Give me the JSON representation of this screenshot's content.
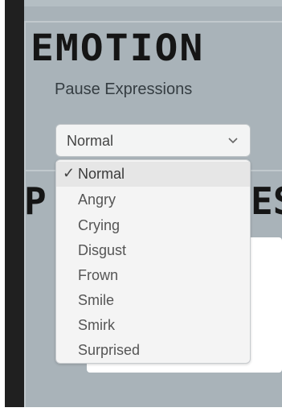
{
  "panel": {
    "emotion_title": "EMOTION",
    "subtitle": "Pause Expressions",
    "second_title_left": "P",
    "second_title_right": "ES"
  },
  "select": {
    "value": "Normal",
    "chevron_icon": "chevron-down-icon"
  },
  "dropdown": {
    "selected_icon": "checkmark-icon",
    "options": [
      {
        "label": "Normal",
        "selected": true
      },
      {
        "label": "Angry"
      },
      {
        "label": "Crying"
      },
      {
        "label": "Disgust"
      },
      {
        "label": "Frown"
      },
      {
        "label": "Smile"
      },
      {
        "label": "Smirk"
      },
      {
        "label": "Surprised"
      }
    ]
  },
  "colors": {
    "panel_bg": "#a8b2b8",
    "left_bar": "#202020",
    "dropdown_bg": "#f4f4f4",
    "selected_bg": "#e6e6e6"
  }
}
